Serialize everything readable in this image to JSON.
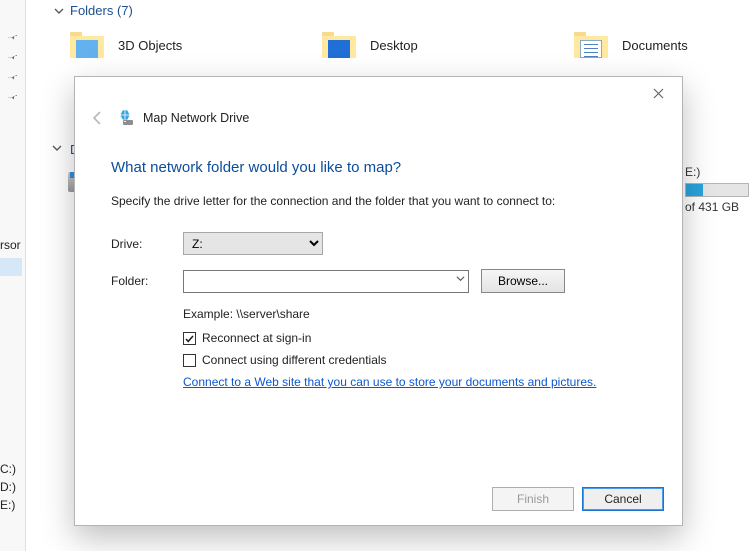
{
  "sidebar_fragments": {
    "rsor": "rsor",
    "c": "C:)",
    "d": "D:)",
    "e": "E:)"
  },
  "folders_header": "Folders (7)",
  "folders": {
    "a": "3D Objects",
    "b": "Desktop",
    "c": "Documents"
  },
  "drives_header_letter": "D",
  "right_sliver": {
    "drive_label": "E:)",
    "free": "of 431 GB"
  },
  "wizard": {
    "title": "Map Network Drive",
    "heading": "What network folder would you like to map?",
    "subtext": "Specify the drive letter for the connection and the folder that you want to connect to:",
    "drive_label": "Drive:",
    "drive_value": "Z:",
    "folder_label": "Folder:",
    "browse": "Browse...",
    "example": "Example: \\\\server\\share",
    "reconnect": "Reconnect at sign-in",
    "diff_creds": "Connect using different credentials",
    "link": "Connect to a Web site that you can use to store your documents and pictures",
    "finish": "Finish",
    "cancel": "Cancel"
  }
}
